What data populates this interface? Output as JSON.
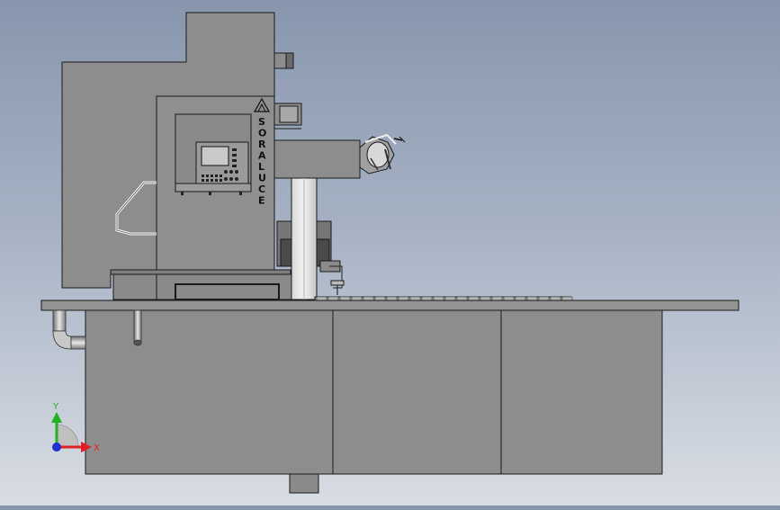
{
  "viewport": {
    "background_top": "#8896ad",
    "background_bottom": "#d9dde4",
    "body_color": "#8d8d8d",
    "outline_color": "#1a1a1a"
  },
  "model": {
    "brand": "SORALUCE",
    "brand_letters": [
      "S",
      "O",
      "R",
      "A",
      "L",
      "U",
      "C",
      "E"
    ]
  },
  "triad": {
    "x_label": "X",
    "y_label": "Y",
    "x_color": "#e02020",
    "y_color": "#20b020",
    "z_color": "#2030d0"
  }
}
